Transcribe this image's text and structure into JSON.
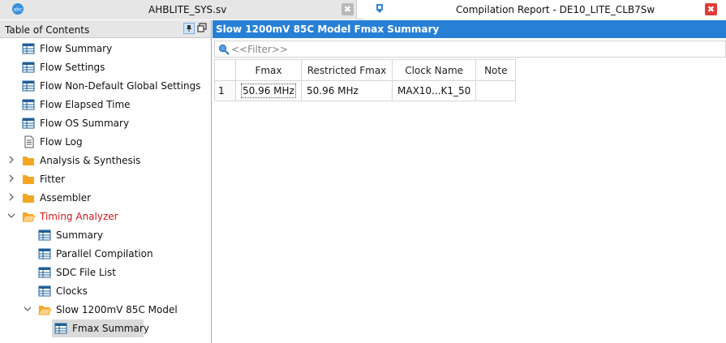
{
  "tabs": [
    {
      "title": "AHBLITE_SYS.sv",
      "icon": "sv-file-icon",
      "close": "✖"
    },
    {
      "title": "Compilation Report - DE10_LITE_CLB7Sw",
      "icon": "report-icon",
      "close": "✖"
    }
  ],
  "toc": {
    "title": "Table of Contents",
    "items": [
      {
        "label": "Flow Summary",
        "icon": "table-icon"
      },
      {
        "label": "Flow Settings",
        "icon": "table-icon"
      },
      {
        "label": "Flow Non-Default Global Settings",
        "icon": "table-icon"
      },
      {
        "label": "Flow Elapsed Time",
        "icon": "table-icon"
      },
      {
        "label": "Flow OS Summary",
        "icon": "table-icon"
      },
      {
        "label": "Flow Log",
        "icon": "document-icon"
      },
      {
        "label": "Analysis & Synthesis",
        "icon": "folder-icon"
      },
      {
        "label": "Fitter",
        "icon": "folder-icon"
      },
      {
        "label": "Assembler",
        "icon": "folder-icon"
      },
      {
        "label": "Timing Analyzer",
        "icon": "folder-open-icon"
      },
      {
        "label": "Summary",
        "icon": "table-icon"
      },
      {
        "label": "Parallel Compilation",
        "icon": "table-icon"
      },
      {
        "label": "SDC File List",
        "icon": "table-icon"
      },
      {
        "label": "Clocks",
        "icon": "table-icon"
      },
      {
        "label": "Slow 1200mV 85C Model",
        "icon": "folder-open-icon"
      },
      {
        "label": "Fmax Summary",
        "icon": "table-icon"
      }
    ]
  },
  "report": {
    "title": "Slow 1200mV 85C Model Fmax Summary",
    "filter_placeholder": "<<Filter>>",
    "columns": [
      "",
      "Fmax",
      "Restricted Fmax",
      "Clock Name",
      "Note"
    ],
    "rows": [
      [
        "1",
        "50.96 MHz",
        "50.96 MHz",
        "MAX10...K1_50",
        ""
      ]
    ]
  },
  "colors": {
    "title_bar": "#2780d6",
    "folder": "#f5a623",
    "active_text": "#d01919",
    "close_red": "#e23b36"
  }
}
